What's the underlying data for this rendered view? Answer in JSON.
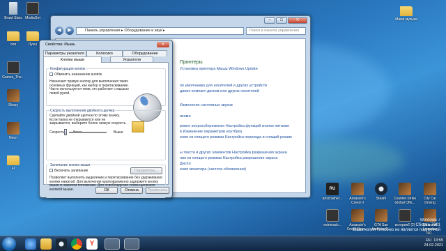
{
  "desktop_icons": [
    {
      "id": "brawl",
      "label": "Brawl Stars",
      "kind": "bin"
    },
    {
      "id": "mediaget",
      "label": "MediaGet",
      "kind": "app"
    },
    {
      "id": "olya",
      "label": "оля",
      "kind": "folder"
    },
    {
      "id": "luchsh",
      "label": "Лучш",
      "kind": "folder"
    },
    {
      "id": "games",
      "label": "Games_The...",
      "kind": "app"
    },
    {
      "id": "skopy",
      "label": "Skopy",
      "kind": "game"
    },
    {
      "id": "neon",
      "label": "Neon",
      "kind": "game"
    },
    {
      "id": "fr",
      "label": "Fr",
      "kind": "folder"
    },
    {
      "id": "mama",
      "label": "Мама музыка",
      "kind": "folder"
    },
    {
      "id": "anscrasher",
      "label": "anscrasher...",
      "kind": "rf"
    },
    {
      "id": "assassin1",
      "label": "Assassin's Creed II",
      "kind": "game"
    },
    {
      "id": "steam",
      "label": "Steam",
      "kind": "steam"
    },
    {
      "id": "cs",
      "label": "Counter-Strike Global Offe...",
      "kind": "game"
    },
    {
      "id": "citycar",
      "label": "City Car Driving",
      "kind": "game"
    },
    {
      "id": "extremack",
      "label": "extrimack...",
      "kind": "app"
    },
    {
      "id": "assassin2",
      "label": "Assassin's Creed Reve...",
      "kind": "game"
    },
    {
      "id": "gta",
      "label": "GTA San Andreas S...",
      "kind": "game"
    },
    {
      "id": "istoriya",
      "label": "история2 (2)",
      "kind": "app"
    },
    {
      "id": "minecraft",
      "label": "Minecraft Launcher 760...",
      "kind": "game"
    }
  ],
  "explorer": {
    "address": "Панель управления ▸ Оборудование и звук ▸",
    "search_placeholder": "Поиск в панели управления",
    "rows": [
      {
        "text": "Принтеры",
        "heading": true
      },
      {
        "text": "Установка принтера   Мышь   Windows Update",
        "heading": false
      },
      {
        "text": "по умолчанию для носителей и других устройств",
        "heading": false
      },
      {
        "text": "дание компакт-дисков или других носителей",
        "heading": false
      },
      {
        "text": "Изменение системных звуков",
        "heading": false
      },
      {
        "text": "иками",
        "heading": false
      },
      {
        "text": "ровня энергосбережения   Настройка функций кнопок питания",
        "heading": false
      },
      {
        "text": "в   Изменение параметров ноутбука",
        "heading": false
      },
      {
        "text": "ения из спящего режима   Настройка перехода в спящий режим",
        "heading": false
      },
      {
        "text": "ы текста и других элементов   Настройка разрешения экрана",
        "heading": false
      },
      {
        "text": "ния из спящего режима   Настройка разрешения экрана",
        "heading": false
      },
      {
        "text": "Диспл",
        "heading": false
      },
      {
        "text": "ения монитора (частота обновления)",
        "heading": false
      }
    ]
  },
  "dialog": {
    "title": "Свойства: Мышь",
    "tabs_row1": [
      "Параметры указателя",
      "Колесико",
      "Оборудование"
    ],
    "tabs_row2": [
      "Кнопки мыши",
      "Указатели"
    ],
    "grp1_title": "Конфигурация кнопок",
    "swap_label": "Обменять назначение кнопок",
    "swap_desc": "Назначает правую кнопку для выполнения таких основных функций, как выбор и перетаскивание. Часто используется теми, кто работает с мышью левой рукой.",
    "grp2_title": "Скорость выполнения двойного щелчка",
    "dbl_desc": "Сделайте двойной щелчок по этому значку. Если папка не открывается или не закрывается, выберите более низкую скорость.",
    "speed_label": "Скорость:",
    "low": "Ниже",
    "high": "Выше",
    "speed_value": 0.45,
    "grp3_title": "Залипание кнопки мыши",
    "clicklock_label": "Включить залипание",
    "params_btn": "Параметры...",
    "clicklock_desc": "Позволяет выполнять выделение и перетаскивание без удерживания кнопки нажатой. Для включения кратковременно задержите кнопку мыши в нажатом положении. Для освобождения снова щелкните кнопкой мыши.",
    "ok": "ОК",
    "cancel": "Отмена",
    "apply": "Применить"
  },
  "taskbar": {
    "lang": "RU",
    "time": "13:55",
    "date": "24.02.2021"
  },
  "watermark": {
    "line1": "Windows 7",
    "line2": "Сборка 7601",
    "line3": "Ваша копия Windows не является подлинной"
  }
}
